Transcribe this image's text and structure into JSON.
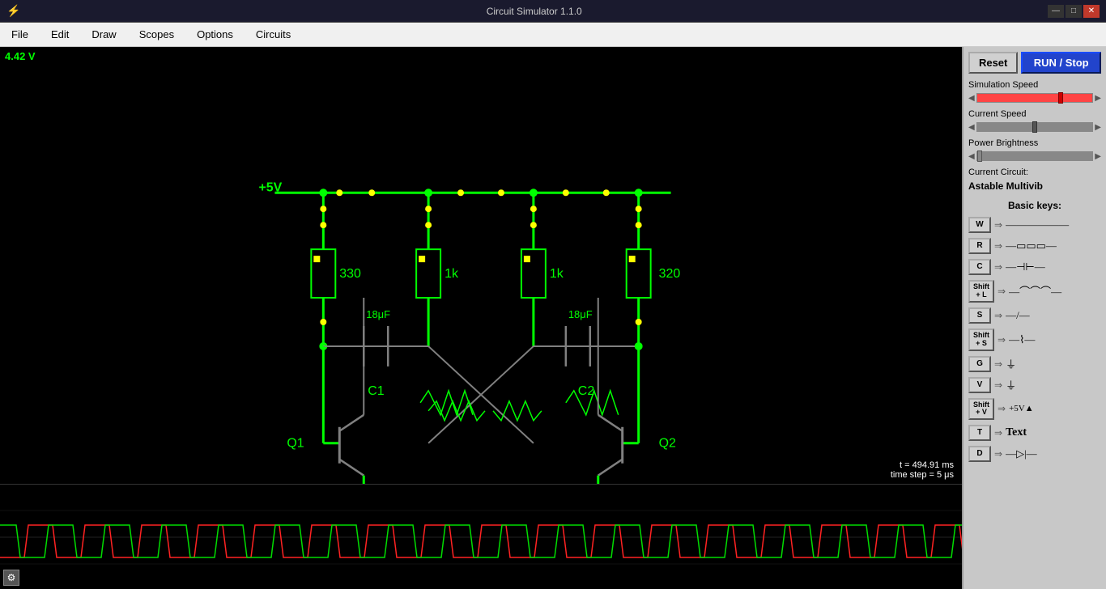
{
  "titlebar": {
    "title": "Circuit Simulator 1.1.0",
    "icon": "⚡",
    "min_btn": "—",
    "max_btn": "□",
    "close_btn": "✕"
  },
  "menubar": {
    "items": [
      "File",
      "Edit",
      "Draw",
      "Scopes",
      "Options",
      "Circuits"
    ]
  },
  "right_panel": {
    "reset_label": "Reset",
    "run_stop_label": "RUN / Stop",
    "simulation_speed_label": "Simulation Speed",
    "current_speed_label": "Current Speed",
    "power_brightness_label": "Power Brightness",
    "current_circuit_label": "Current Circuit:",
    "current_circuit_name": "Astable Multivib",
    "basic_keys_title": "Basic keys:",
    "sim_speed_value": 75,
    "cur_speed_value": 50,
    "keys": [
      {
        "key": "W",
        "desc": "wire"
      },
      {
        "key": "R",
        "desc": "resistor"
      },
      {
        "key": "C",
        "desc": "capacitor"
      },
      {
        "key": "Shift\n+ L",
        "desc": "inductor"
      },
      {
        "key": "S",
        "desc": "switch"
      },
      {
        "key": "Shift\n+ S",
        "desc": "voltage source"
      },
      {
        "key": "G",
        "desc": "ground"
      },
      {
        "key": "V",
        "desc": "ground2"
      },
      {
        "key": "Shift\n+ V",
        "desc": "+5V"
      },
      {
        "key": "T",
        "desc": "Text"
      },
      {
        "key": "D",
        "desc": "diode"
      }
    ]
  },
  "canvas": {
    "voltage_label": "4.42 V",
    "sim_time": "t = 494.91 ms",
    "time_step": "time step = 5 μs",
    "circuit_labels": {
      "vcc": "+5V",
      "r1": "330",
      "r2": "1k",
      "r3": "1k",
      "r4": "320",
      "c1": "18μF",
      "c2": "18μF",
      "t1": "Q1",
      "t2": "Q2",
      "cap1_label": "C1",
      "cap2_label": "C2"
    }
  }
}
